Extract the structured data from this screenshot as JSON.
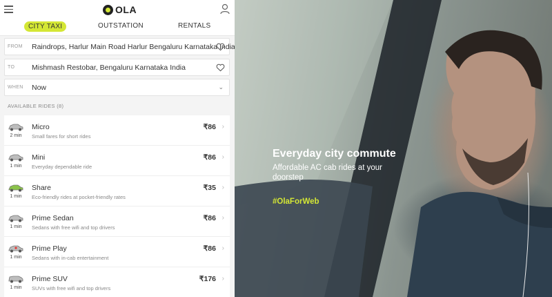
{
  "header": {
    "brand": "OLA"
  },
  "tabs": [
    {
      "label": "CITY TAXI",
      "active": true
    },
    {
      "label": "OUTSTATION",
      "active": false
    },
    {
      "label": "RENTALS",
      "active": false
    }
  ],
  "form": {
    "from": {
      "label": "FROM",
      "value": "Raindrops, Harlur Main Road Harlur Bengaluru Karnataka India"
    },
    "to": {
      "label": "TO",
      "value": "Mishmash Restobar, Bengaluru Karnataka India"
    },
    "when": {
      "label": "WHEN",
      "value": "Now"
    }
  },
  "available_label": "AVAILABLE RIDES (8)",
  "rides": [
    {
      "name": "Micro",
      "desc": "Small fares for short rides",
      "eta": "2 min",
      "price": "₹86",
      "car_color": "#bdbdbd"
    },
    {
      "name": "Mini",
      "desc": "Everyday dependable ride",
      "eta": "1 min",
      "price": "₹86",
      "car_color": "#bdbdbd"
    },
    {
      "name": "Share",
      "desc": "Eco-friendly rides at pocket-friendly rates",
      "eta": "1 min",
      "price": "₹35",
      "car_color": "#8bc34a"
    },
    {
      "name": "Prime Sedan",
      "desc": "Sedans with free wifi and top drivers",
      "eta": "1 min",
      "price": "₹86",
      "car_color": "#bdbdbd"
    },
    {
      "name": "Prime Play",
      "desc": "Sedans with in-cab entertainment",
      "eta": "1 min",
      "price": "₹86",
      "car_color": "#bdbdbd"
    },
    {
      "name": "Prime SUV",
      "desc": "SUVs with free wifi and top drivers",
      "eta": "1 min",
      "price": "₹176",
      "car_color": "#bdbdbd"
    }
  ],
  "hero": {
    "title": "Everyday city commute",
    "subtitle": "Affordable AC cab rides at your doorstep",
    "hashtag": "#OlaForWeb"
  },
  "colors": {
    "accent": "#d4e735"
  }
}
